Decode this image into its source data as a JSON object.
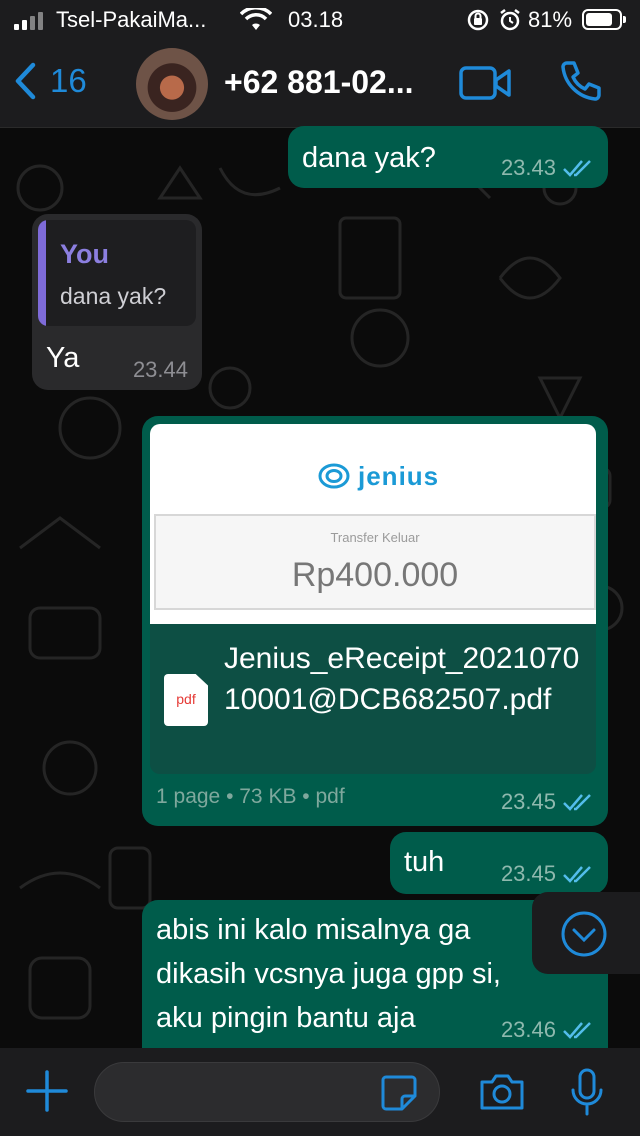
{
  "status_bar": {
    "carrier": "Tsel-PakaiMa...",
    "time": "03.18",
    "battery": "81%",
    "battery_level": 0.81
  },
  "header": {
    "back_count": "16",
    "contact_name": "+62 881-02...",
    "back_icon": "chevron-left-icon",
    "video_icon": "video-camera-icon",
    "call_icon": "phone-icon"
  },
  "messages": [
    {
      "direction": "out",
      "text": "dana yak?",
      "time": "23.43",
      "status": "read"
    },
    {
      "direction": "in",
      "reply_to": {
        "author": "You",
        "text": "dana yak?"
      },
      "text": "Ya",
      "time": "23.44"
    },
    {
      "direction": "out",
      "document": {
        "preview": {
          "brand": "jenius",
          "label": "Transfer Keluar",
          "amount": "Rp400.000"
        },
        "icon_label": "pdf",
        "filename": "Jenius_eReceipt_202107010001@DCB682507.pdf",
        "info": "1 page • 73 KB • pdf"
      },
      "time": "23.45",
      "status": "read"
    },
    {
      "direction": "out",
      "text": "tuh",
      "time": "23.45",
      "status": "read"
    },
    {
      "direction": "out",
      "lines": [
        "abis ini kalo misalnya ga",
        "dikasih vcsnya juga gpp si,",
        "aku pingin bantu aja"
      ],
      "time": "23.46",
      "status": "read"
    }
  ],
  "input_bar": {
    "placeholder": "",
    "plus_icon": "plus-icon",
    "sticker_icon": "sticker-icon",
    "camera_icon": "camera-icon",
    "mic_icon": "microphone-icon"
  },
  "colors": {
    "outgoing_bubble": "#005c4b",
    "incoming_bubble": "#2a2a2c",
    "accent": "#1f8ad9",
    "read_ticks": "#53bdeb",
    "reply_author": "#8c7fe0"
  }
}
